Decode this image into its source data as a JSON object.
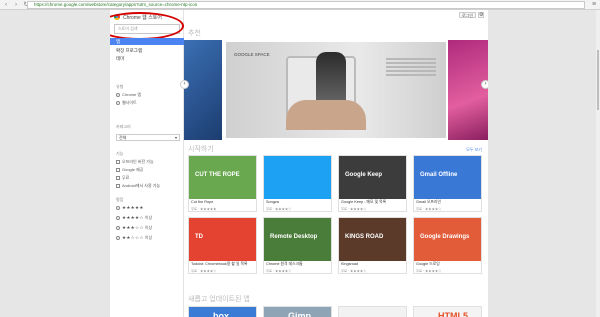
{
  "browser": {
    "url": "https://chrome.google.com/webstore/category/apps?utm_source=chrome-ntp-icon"
  },
  "store": {
    "title": "Chrome 웹 스토어",
    "search_placeholder": "스토어 검색",
    "nav": [
      "앱",
      "확장 프로그램",
      "테마"
    ],
    "filter_heading": "유형",
    "type_options": [
      "Chrome 앱",
      "웹사이트"
    ],
    "category_heading": "카테고리",
    "category_value": "전체",
    "features_heading": "기능",
    "feature_options": [
      "오프라인 버전 가능",
      "Google 제공",
      "무료",
      "Android에서 사용 가능"
    ],
    "rating_heading": "평점",
    "ratings": [
      {
        "stars": "★★★★★",
        "suffix": ""
      },
      {
        "stars": "★★★★☆",
        "suffix": "이상"
      },
      {
        "stars": "★★★☆☆",
        "suffix": "이상"
      },
      {
        "stars": "★★☆☆☆",
        "suffix": "이상"
      }
    ]
  },
  "header": {
    "login_label": "로그인",
    "gear_icon": "gear-icon"
  },
  "featured": {
    "section_title": "추천",
    "brand": "GOOGLE SPACE"
  },
  "getting_started": {
    "section_title": "시작하기",
    "more_label": "모두 보기",
    "apps": [
      {
        "name": "Cut the Rope",
        "sub": "무료 · ★★★★★",
        "color": "#6aa84f",
        "label": "CUT THE ROPE"
      },
      {
        "name": "Songza",
        "sub": "무료 · ★★★★☆",
        "color": "#1da1f2",
        "label": ""
      },
      {
        "name": "Google Keep - 메모 및 목록",
        "sub": "무료 · ★★★★☆",
        "color": "#3c3c3c",
        "label": "Google Keep"
      },
      {
        "name": "Gmail 오프라인",
        "sub": "무료 · ★★★★☆",
        "color": "#3a78d6",
        "label": "Gmail Offline"
      },
      {
        "name": "Todoist: Chromebook용 할 일 목록",
        "sub": "무료 · ★★★★☆",
        "color": "#e44332",
        "label": "TD"
      },
      {
        "name": "Chrome 원격 데스크톱",
        "sub": "무료 · ★★★★☆",
        "color": "#4a7d3a",
        "label": "Remote Desktop"
      },
      {
        "name": "Kingsroad",
        "sub": "무료 · ★★★★☆",
        "color": "#5b3a2a",
        "label": "KINGS ROAD"
      },
      {
        "name": "Google 드로잉",
        "sub": "무료 · ★★★★☆",
        "color": "#e25c3a",
        "label": "Google Drawings"
      }
    ]
  },
  "updates": {
    "section_title": "새롭고 업데이트된 앱",
    "apps": [
      {
        "label": "box",
        "color": "#3a7bd5"
      },
      {
        "label": "Gimp",
        "color": "#8fa4b4"
      },
      {
        "label": "",
        "color": "#f2f2f2"
      },
      {
        "label": "HTML5",
        "color": "#f4f4f4"
      }
    ]
  }
}
